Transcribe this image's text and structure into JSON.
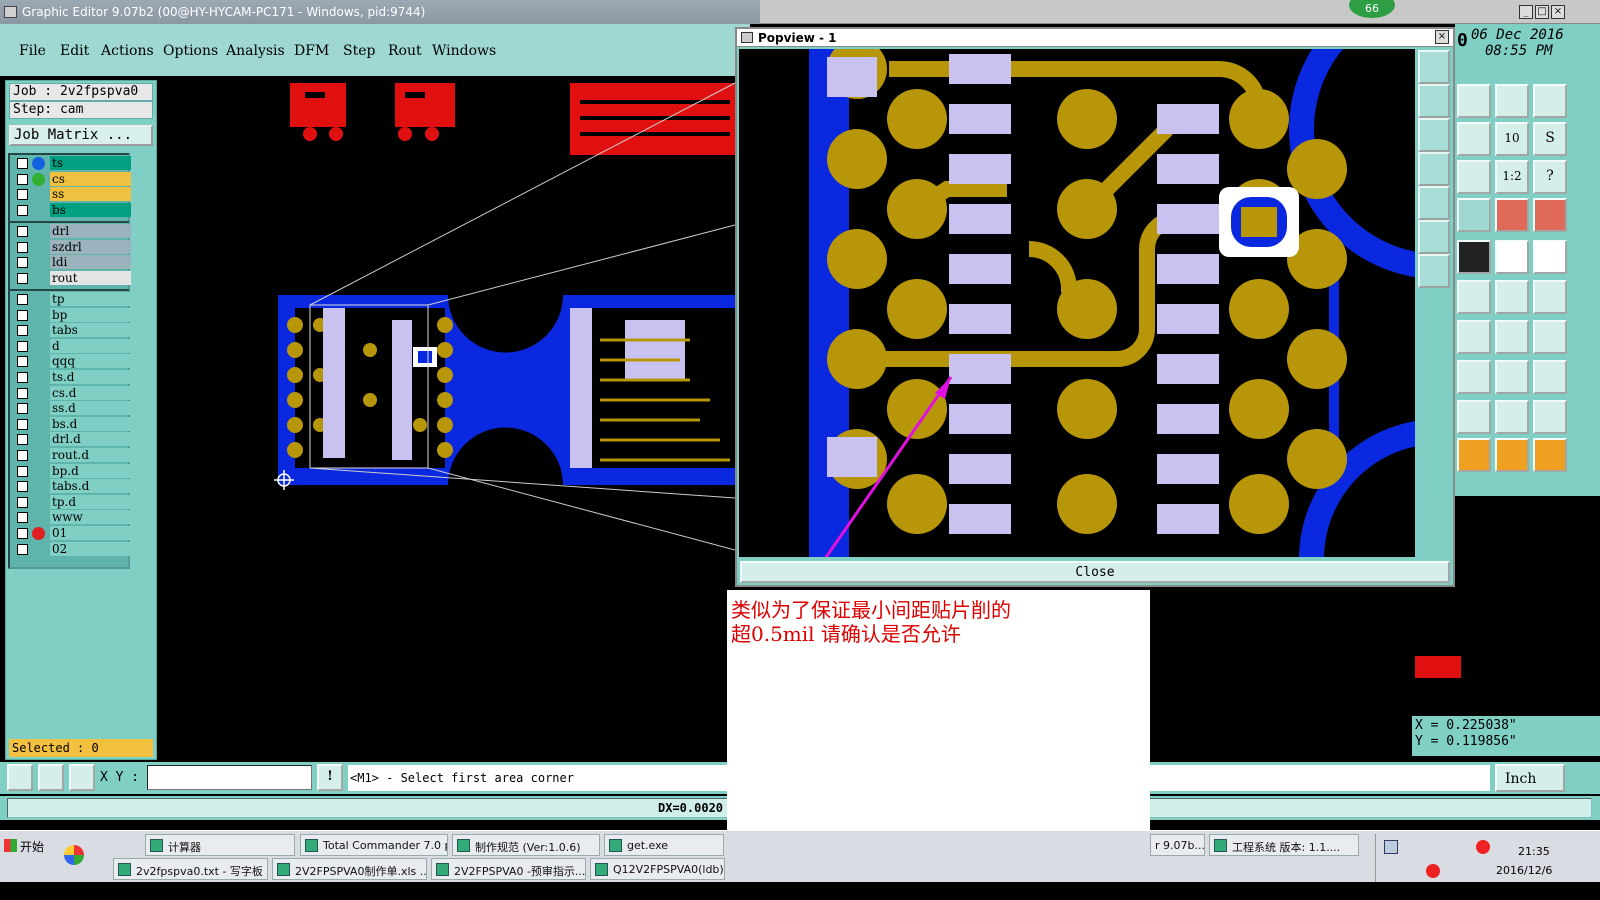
{
  "window": {
    "title": "Graphic Editor 9.07b2 (00@HY-HYCAM-PC171 - Windows, pid:9744)",
    "badge": "66"
  },
  "menu": [
    "File",
    "Edit",
    "Actions",
    "Options",
    "Analysis",
    "DFM",
    "Step",
    "Rout",
    "Windows"
  ],
  "left_panel": {
    "job": "Job : 2v2fpspva0",
    "step": "Step: cam",
    "job_matrix": "Job Matrix ...",
    "groups": [
      [
        {
          "name": "ts",
          "color": "#00a080",
          "dot": "#1060e0"
        },
        {
          "name": "cs",
          "color": "#f0c040",
          "dot": "#30b030"
        },
        {
          "name": "ss",
          "color": "#f0c040",
          "dot": ""
        },
        {
          "name": "bs",
          "color": "#00a080",
          "dot": ""
        }
      ],
      [
        {
          "name": "drl",
          "color": "#9ab3bd",
          "dot": ""
        },
        {
          "name": "szdrl",
          "color": "#9ab3bd",
          "dot": ""
        },
        {
          "name": "ldi",
          "color": "#9ab3bd",
          "dot": ""
        },
        {
          "name": "rout",
          "color": "#e4e4e4",
          "dot": ""
        }
      ],
      [
        {
          "name": "tp",
          "color": "#7fcfc5",
          "dot": ""
        },
        {
          "name": "bp",
          "color": "#7fcfc5",
          "dot": ""
        },
        {
          "name": "tabs",
          "color": "#7fcfc5",
          "dot": ""
        },
        {
          "name": "d",
          "color": "#7fcfc5",
          "dot": ""
        },
        {
          "name": "qqq",
          "color": "#7fcfc5",
          "dot": ""
        },
        {
          "name": "ts.d",
          "color": "#7fcfc5",
          "dot": ""
        },
        {
          "name": "cs.d",
          "color": "#7fcfc5",
          "dot": ""
        },
        {
          "name": "ss.d",
          "color": "#7fcfc5",
          "dot": ""
        },
        {
          "name": "bs.d",
          "color": "#7fcfc5",
          "dot": ""
        },
        {
          "name": "drl.d",
          "color": "#7fcfc5",
          "dot": ""
        },
        {
          "name": "rout.d",
          "color": "#7fcfc5",
          "dot": ""
        },
        {
          "name": "bp.d",
          "color": "#7fcfc5",
          "dot": ""
        },
        {
          "name": "tabs.d",
          "color": "#7fcfc5",
          "dot": ""
        },
        {
          "name": "tp.d",
          "color": "#7fcfc5",
          "dot": ""
        },
        {
          "name": "www",
          "color": "#7fcfc5",
          "dot": ""
        },
        {
          "name": "01",
          "color": "#7fcfc5",
          "dot": "#e02020"
        },
        {
          "name": "02",
          "color": "#7fcfc5",
          "dot": ""
        }
      ]
    ],
    "selected": "Selected : 0"
  },
  "popup": {
    "title": "Popview - 1",
    "close_label": "Close"
  },
  "clock": {
    "date": "06 Dec 2016",
    "time": "08:55 PM",
    "extra": "0"
  },
  "coords": {
    "x": "X = 0.225038\"",
    "y": "Y = 0.119856\""
  },
  "note": {
    "line1": "类似为了保证最小间距贴片削的",
    "line2": "超0.5mil  请确认是否允许"
  },
  "command": {
    "xy_label": "X Y :",
    "xy_value": "",
    "prompt": "<M1> - Select first area corner",
    "unit": "Inch"
  },
  "status": {
    "dx": "DX=0.0020"
  },
  "taskbar": {
    "start": "开始",
    "row1": [
      "计算器",
      "Total Commander 7.0 p...",
      "制作规范 (Ver:1.0.6)",
      "get.exe"
    ],
    "row2": [
      "2v2fpspva0.txt - 写字板",
      "2V2FPSPVA0制作单.xls ...",
      "2V2FPSPVA0 -预审指示...",
      "Q12V2FPSPVA0(ldb)201..."
    ],
    "right_tasks": [
      "r 9.07b...",
      "工程系统  版本: 1.1...."
    ],
    "time": "21:35",
    "date": "2016/12/6"
  },
  "colors": {
    "panel": "#7fcfc5",
    "copper": "#b8960a",
    "mask": "#0a28e0",
    "pad": "#c9c2f0",
    "trace_red": "#e01010",
    "accent_orange": "#f0a020"
  }
}
